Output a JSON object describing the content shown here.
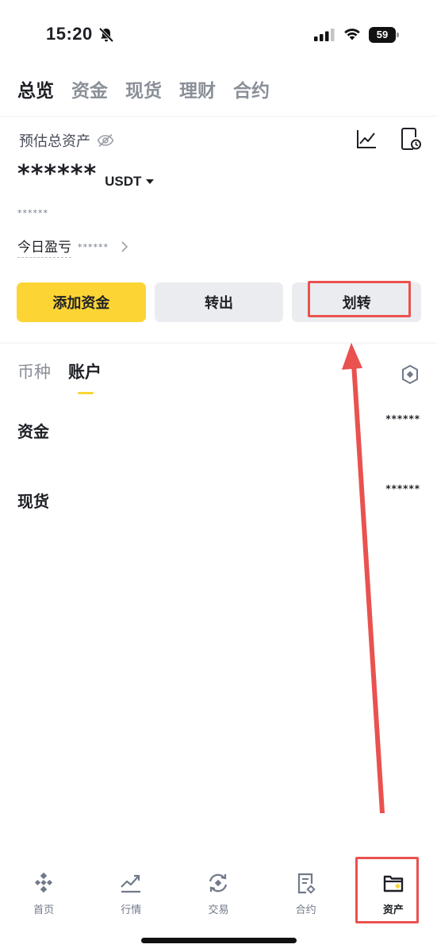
{
  "status_bar": {
    "time": "15:20",
    "battery": "59"
  },
  "top_tabs": [
    "总览",
    "资金",
    "现货",
    "理财",
    "合约"
  ],
  "overview": {
    "estimated_label": "预估总资产",
    "balance": "******",
    "currency": "USDT",
    "sub_balance": "******",
    "pnl_label": "今日盈亏",
    "pnl_value": "******"
  },
  "actions": {
    "add_funds": "添加资金",
    "withdraw": "转出",
    "transfer": "划转"
  },
  "sub_tabs": [
    "币种",
    "账户"
  ],
  "accounts": [
    {
      "name": "资金",
      "value": "******"
    },
    {
      "name": "现货",
      "value": "******"
    }
  ],
  "bottom_nav": [
    "首页",
    "行情",
    "交易",
    "合约",
    "资产"
  ],
  "colors": {
    "brand_yellow": "#fcd535",
    "annotation_red": "#e9524f"
  }
}
